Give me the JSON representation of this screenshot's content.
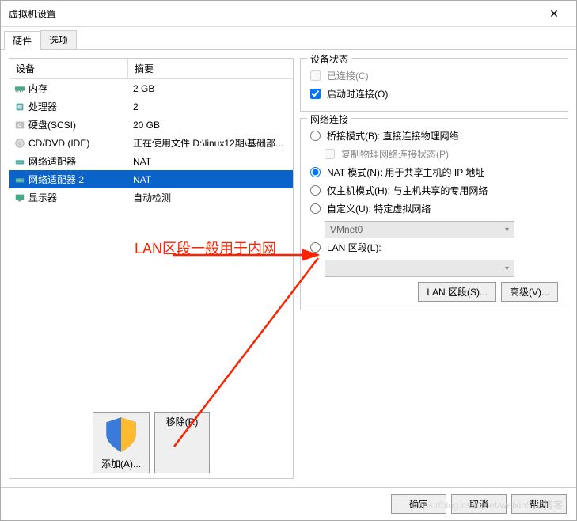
{
  "window": {
    "title": "虚拟机设置"
  },
  "tabs": [
    "硬件",
    "选项"
  ],
  "active_tab": 0,
  "list": {
    "headers": [
      "设备",
      "摘要"
    ],
    "rows": [
      {
        "icon": "memory",
        "name": "内存",
        "summary": "2 GB"
      },
      {
        "icon": "cpu",
        "name": "处理器",
        "summary": "2"
      },
      {
        "icon": "disk",
        "name": "硬盘(SCSI)",
        "summary": "20 GB"
      },
      {
        "icon": "cd",
        "name": "CD/DVD (IDE)",
        "summary": "正在使用文件 D:\\linux12期\\基础部..."
      },
      {
        "icon": "net",
        "name": "网络适配器",
        "summary": "NAT"
      },
      {
        "icon": "net",
        "name": "网络适配器 2",
        "summary": "NAT",
        "selected": true
      },
      {
        "icon": "display",
        "name": "显示器",
        "summary": "自动检测"
      }
    ]
  },
  "device_status": {
    "title": "设备状态",
    "connected_label": "已连接(C)",
    "connected_checked": false,
    "connected_disabled": true,
    "startup_label": "启动时连接(O)",
    "startup_checked": true
  },
  "network": {
    "title": "网络连接",
    "radios": {
      "bridge": "桥接模式(B): 直接连接物理网络",
      "replicate": "复制物理网络连接状态(P)",
      "nat": "NAT 模式(N): 用于共享主机的 IP 地址",
      "hostonly": "仅主机模式(H): 与主机共享的专用网络",
      "custom": "自定义(U): 特定虚拟网络",
      "custom_net": "VMnet0",
      "lan": "LAN 区段(L):"
    },
    "selected": "nat",
    "buttons": {
      "lanseg": "LAN 区段(S)...",
      "advanced": "高级(V)..."
    }
  },
  "add_remove": {
    "add": "添加(A)...",
    "remove": "移除(R)"
  },
  "footer": {
    "ok": "确定",
    "cancel": "取消",
    "help": "帮助"
  },
  "annotation": "LAN区段一般用于内网",
  "watermark": "https://blog.csdn.net/weixin51C博客"
}
